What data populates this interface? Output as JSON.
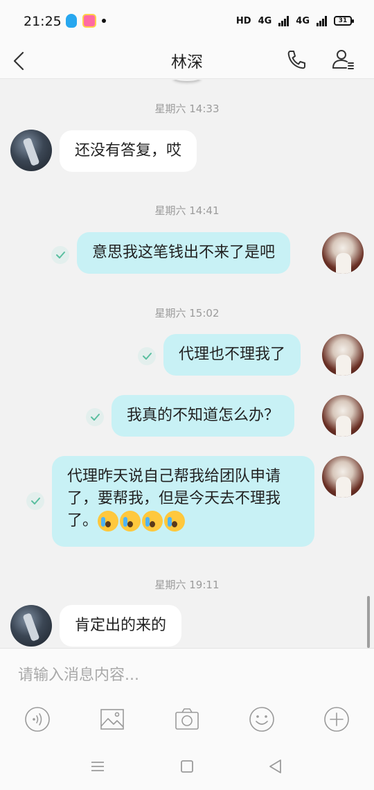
{
  "status_bar": {
    "time": "21:25",
    "hd_label": "HD",
    "network_1": "4G",
    "network_2": "4G",
    "battery_level": "31"
  },
  "header": {
    "title": "林深"
  },
  "messages": [
    {
      "type": "timestamp",
      "text": "星期六 14:33"
    },
    {
      "type": "received",
      "text": "还没有答复，哎"
    },
    {
      "type": "timestamp",
      "text": "星期六 14:41"
    },
    {
      "type": "sent",
      "text": "意思我这笔钱出不来了是吧",
      "read": true
    },
    {
      "type": "timestamp",
      "text": "星期六 15:02"
    },
    {
      "type": "sent",
      "text": "代理也不理我了",
      "read": true
    },
    {
      "type": "sent",
      "text": "我真的不知道怎么办？",
      "read": true
    },
    {
      "type": "sent",
      "text": "代理昨天说自己帮我给团队申请了，要帮我，但是今天去不理我了。",
      "emojis": [
        "loudly-crying-face",
        "loudly-crying-face",
        "loudly-crying-face",
        "loudly-crying-face"
      ],
      "read": true
    },
    {
      "type": "timestamp",
      "text": "星期六 19:11"
    },
    {
      "type": "received",
      "text": "肯定出的来的"
    }
  ],
  "composer": {
    "placeholder": "请输入消息内容..."
  },
  "toolbar_icons": [
    "voice-icon",
    "image-icon",
    "camera-icon",
    "emoji-icon",
    "plus-icon"
  ],
  "colors": {
    "sent_bubble": "#c8f1f5",
    "received_bubble": "#ffffff",
    "background": "#f2f2f2",
    "check": "#5bbfa0"
  }
}
